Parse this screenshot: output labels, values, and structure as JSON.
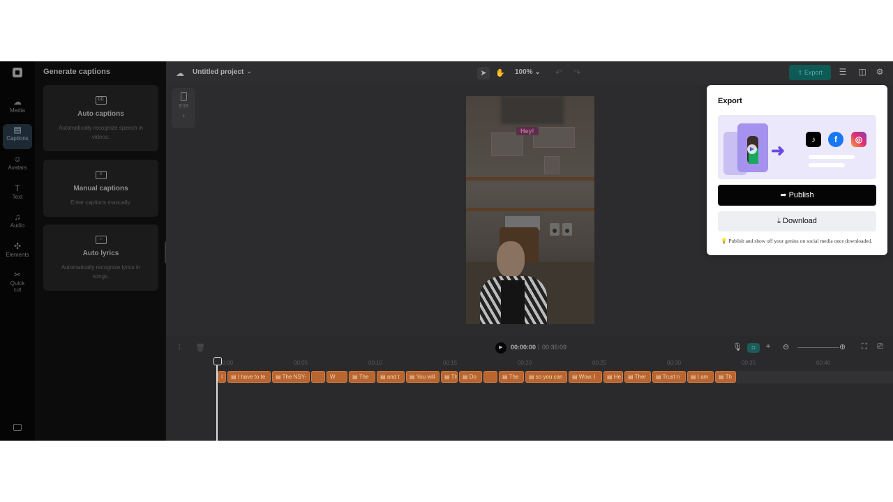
{
  "rail": {
    "items": [
      {
        "label": "Media",
        "icon": "media-icon",
        "glyph": "☁"
      },
      {
        "label": "Captions",
        "icon": "captions-icon",
        "glyph": "▤"
      },
      {
        "label": "Avatars",
        "icon": "avatar-icon",
        "glyph": "☺"
      },
      {
        "label": "Text",
        "icon": "text-icon",
        "glyph": "T"
      },
      {
        "label": "Audio",
        "icon": "audio-icon",
        "glyph": "♫"
      },
      {
        "label": "Elements",
        "icon": "elements-icon",
        "glyph": "✣"
      },
      {
        "label": "Quick",
        "label2": "cut",
        "icon": "quick-cut-icon",
        "glyph": "✂"
      }
    ],
    "active": "Captions"
  },
  "panel": {
    "title": "Generate captions",
    "cards": [
      {
        "title": "Auto captions",
        "desc": "Automatically recognize speech in videos.",
        "icon_text": "CC"
      },
      {
        "title": "Manual captions",
        "desc": "Enter captions manually.",
        "icon_text": "≡"
      },
      {
        "title": "Auto lyrics",
        "desc": "Automatically recognize lyrics in songs.",
        "icon_text": "♪"
      }
    ]
  },
  "topbar": {
    "project_title": "Untitled project",
    "zoom": "100%",
    "export_label": "Export"
  },
  "canvas": {
    "ratio": "9:16",
    "overlay_text": "Hey!"
  },
  "timeline": {
    "current_time": "00:00:00",
    "separator": "|",
    "total_time": "00:36:09",
    "ticks": [
      "00:00",
      "00:05",
      "00:10",
      "00:15",
      "00:20",
      "00:25",
      "00:30",
      "00:35",
      "00:40"
    ],
    "captions": [
      "I",
      "I have to te",
      "The NSY-",
      "",
      "W",
      "The",
      "and t",
      "You will",
      "Th",
      "Do",
      "",
      "The",
      "so you can",
      "Wow, I",
      "He",
      "Ther",
      "Trust n",
      "I am",
      "Th"
    ]
  },
  "export_popup": {
    "title": "Export",
    "publish_label": "Publish",
    "download_label": "Download",
    "note": "Publish and show off your genius on social media once downloaded."
  },
  "colors": {
    "accent_teal": "#0e5a55",
    "caption_orange": "#b86530",
    "publish_black": "#050505",
    "banner_purple": "#ece8fb"
  }
}
